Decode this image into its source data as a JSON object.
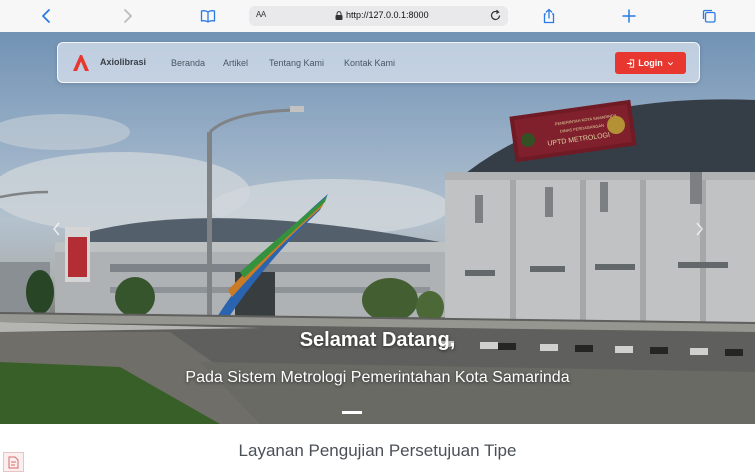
{
  "browser": {
    "text_size_label": "AA",
    "url": "http://127.0.0.1:8000",
    "icons": [
      "chevron-left-icon",
      "chevron-right-icon",
      "book-icon",
      "lock-icon",
      "reload-icon",
      "share-icon",
      "plus-icon",
      "tabs-icon"
    ]
  },
  "navbar": {
    "brand": "Axiolibrasi",
    "links": [
      "Beranda",
      "Artikel",
      "Tentang Kami",
      "Kontak Kami"
    ],
    "login_label": "Login",
    "accent_color": "#e8372f"
  },
  "hero": {
    "title": "Selamat Datang,",
    "subtitle": "Pada Sistem Metrologi Pemerintahan Kota Samarinda",
    "sign_line1": "PEMERINTAH KOTA SAMARINDA",
    "sign_line2": "DINAS PERDAGANGAN",
    "sign_line3": "UPTD METROLOGI"
  },
  "section": {
    "title": "Layanan Pengujian Persetujuan Tipe"
  }
}
